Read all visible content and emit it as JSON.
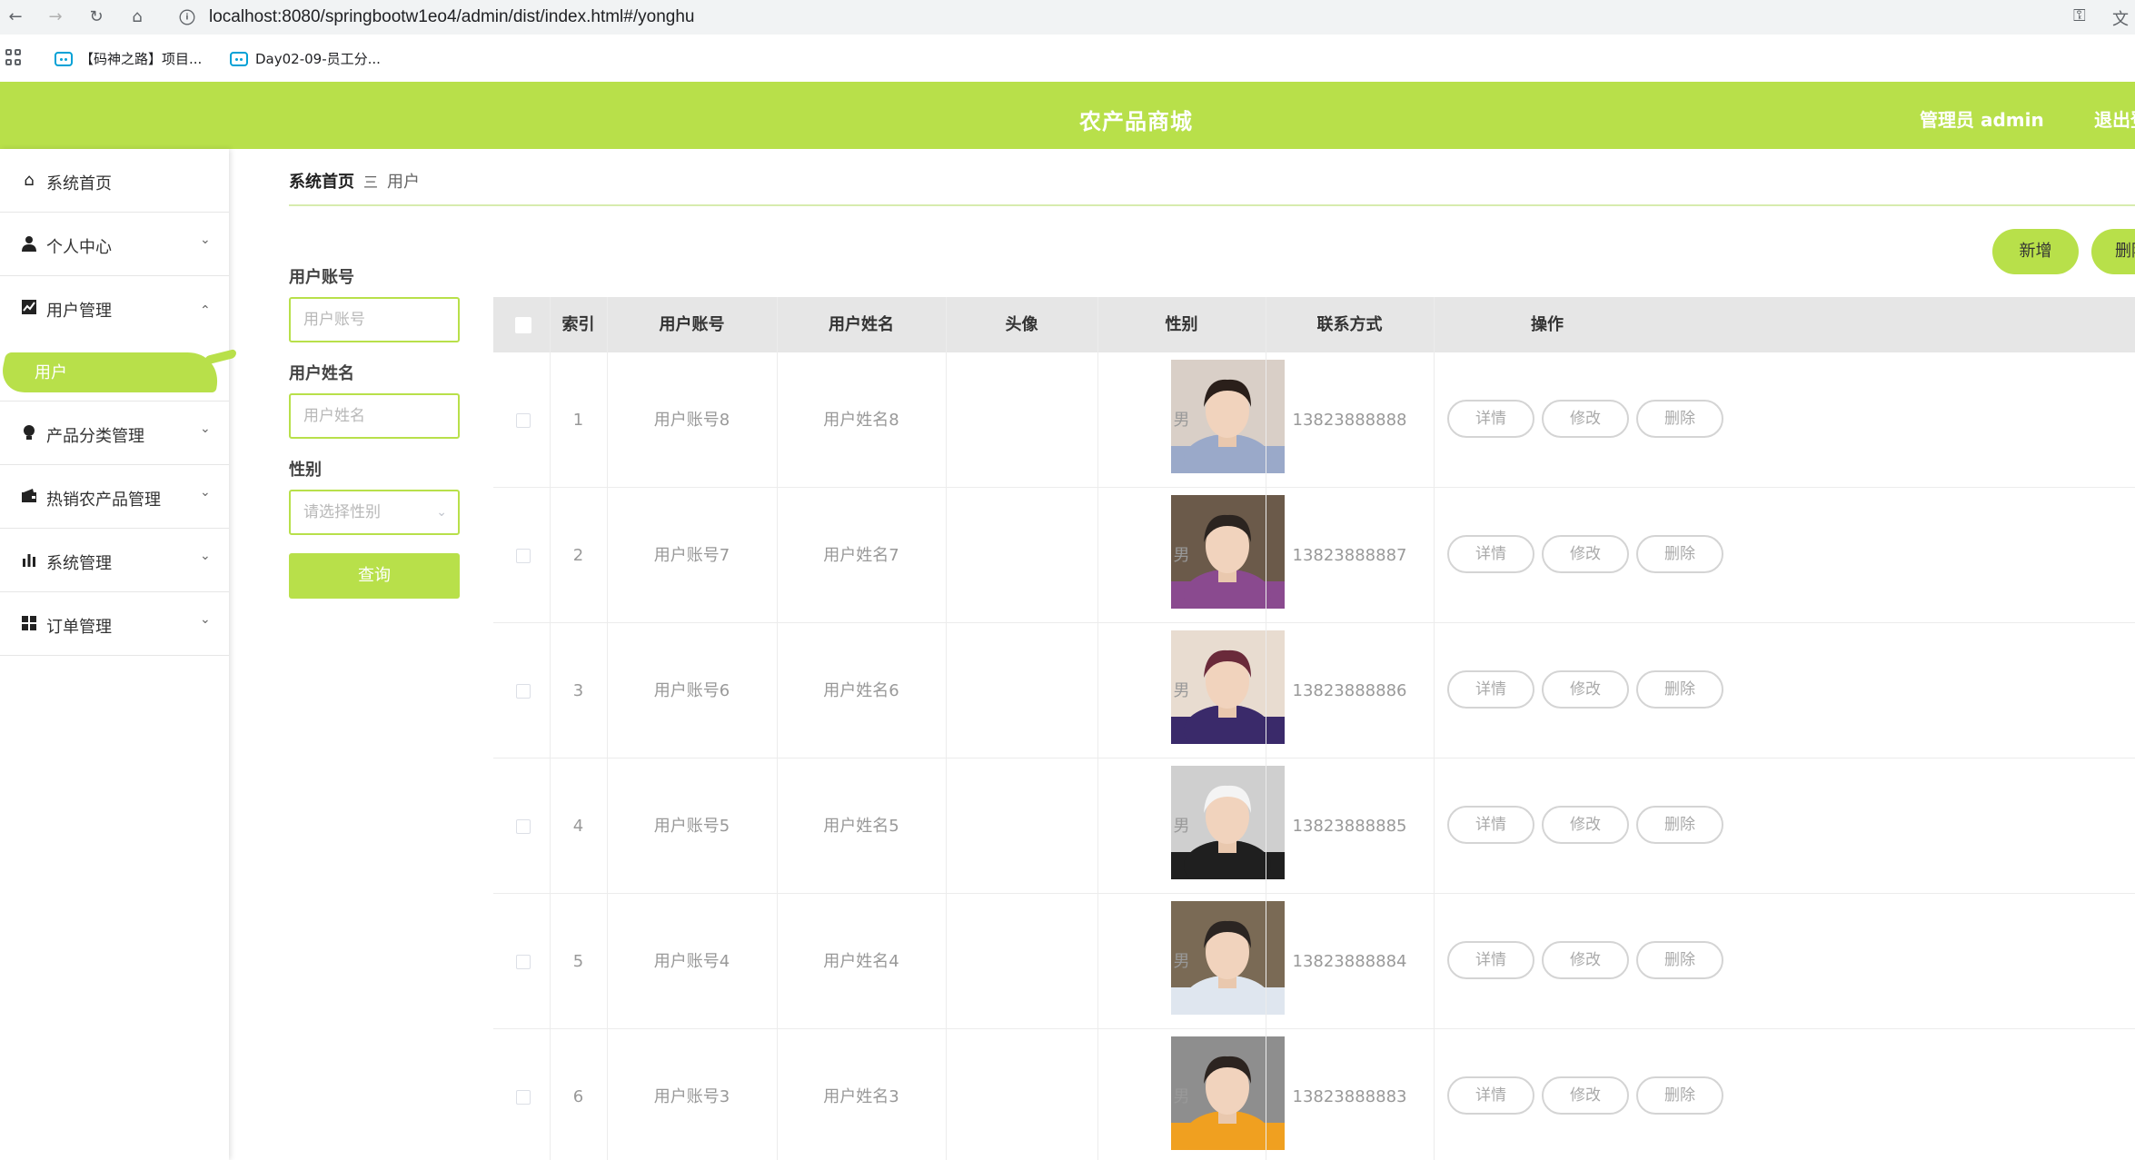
{
  "browser": {
    "url": "localhost:8080/springbootw1eo4/admin/dist/index.html#/yonghu",
    "bookmarks": [
      "【码神之路】项目...",
      "Day02-09-员工分..."
    ]
  },
  "header": {
    "title": "农产品商城",
    "admin": "管理员 admin",
    "logout": "退出登录"
  },
  "sidebar": {
    "items": [
      {
        "label": "系统首页",
        "icon": "home-icon"
      },
      {
        "label": "个人中心",
        "icon": "user-icon"
      },
      {
        "label": "用户管理",
        "icon": "chart-icon"
      },
      {
        "label": "产品分类管理",
        "icon": "bulb-icon"
      },
      {
        "label": "热销农产品管理",
        "icon": "wallet-icon"
      },
      {
        "label": "系统管理",
        "icon": "bar-chart-icon"
      },
      {
        "label": "订单管理",
        "icon": "grid-icon"
      }
    ],
    "active_sub": "用户"
  },
  "breadcrumb": {
    "home": "系统首页",
    "separator": "三",
    "current": "用户"
  },
  "search": {
    "account_label": "用户账号",
    "account_placeholder": "用户账号",
    "name_label": "用户姓名",
    "name_placeholder": "用户姓名",
    "gender_label": "性别",
    "gender_placeholder": "请选择性别",
    "query_button": "查询"
  },
  "actions": {
    "add": "新增",
    "delete": "删除"
  },
  "table": {
    "headers": [
      "索引",
      "用户账号",
      "用户姓名",
      "头像",
      "性别",
      "联系方式",
      "操作"
    ],
    "op_labels": {
      "detail": "详情",
      "edit": "修改",
      "delete": "删除"
    },
    "rows": [
      {
        "index": "1",
        "account": "用户账号8",
        "name": "用户姓名8",
        "gender": "男",
        "phone": "13823888888"
      },
      {
        "index": "2",
        "account": "用户账号7",
        "name": "用户姓名7",
        "gender": "男",
        "phone": "13823888887"
      },
      {
        "index": "3",
        "account": "用户账号6",
        "name": "用户姓名6",
        "gender": "男",
        "phone": "13823888886"
      },
      {
        "index": "4",
        "account": "用户账号5",
        "name": "用户姓名5",
        "gender": "男",
        "phone": "13823888885"
      },
      {
        "index": "5",
        "account": "用户账号4",
        "name": "用户姓名4",
        "gender": "男",
        "phone": "13823888884"
      },
      {
        "index": "6",
        "account": "用户账号3",
        "name": "用户姓名3",
        "gender": "男",
        "phone": "13823888883"
      }
    ]
  },
  "colors": {
    "accent": "#b8e04a",
    "header_bg": "#e6e6e6"
  }
}
